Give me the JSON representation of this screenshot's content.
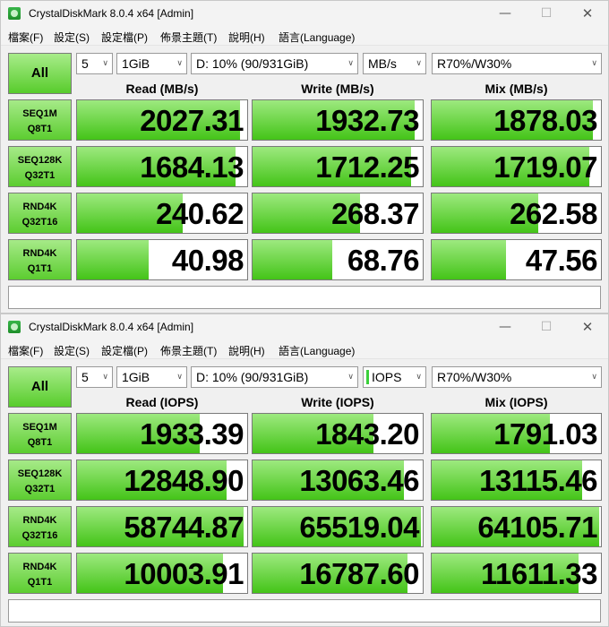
{
  "windows": [
    {
      "title": "CrystalDiskMark 8.0.4 x64 [Admin]",
      "controls": {
        "minimize": "—",
        "maximize": "☐",
        "close": "✕"
      },
      "menu": [
        "檔案(F)",
        "設定(S)",
        "設定檔(P)",
        "佈景主題(T)",
        "說明(H)",
        "語言(Language)"
      ],
      "toolbar": {
        "all_label": "All",
        "count": "5",
        "size": "1GiB",
        "drive": "D: 10% (90/931GiB)",
        "unit": "MB/s",
        "unit_marker": false,
        "mix": "R70%/W30%"
      },
      "columns": [
        "Read (MB/s)",
        "Write (MB/s)",
        "Mix (MB/s)"
      ],
      "rows": [
        {
          "label1": "SEQ1M",
          "label2": "Q8T1",
          "read": "2027.31",
          "write": "1932.73",
          "mix": "1878.03"
        },
        {
          "label1": "SEQ128K",
          "label2": "Q32T1",
          "read": "1684.13",
          "write": "1712.25",
          "mix": "1719.07"
        },
        {
          "label1": "RND4K",
          "label2": "Q32T16",
          "read": "240.62",
          "write": "268.37",
          "mix": "262.58"
        },
        {
          "label1": "RND4K",
          "label2": "Q1T1",
          "read": "40.98",
          "write": "68.76",
          "mix": "47.56"
        }
      ],
      "bar_fractions": [
        [
          0.96,
          0.95,
          0.95
        ],
        [
          0.93,
          0.93,
          0.93
        ],
        [
          0.62,
          0.63,
          0.63
        ],
        [
          0.42,
          0.47,
          0.44
        ]
      ],
      "comment": ""
    },
    {
      "title": "CrystalDiskMark 8.0.4 x64 [Admin]",
      "controls": {
        "minimize": "—",
        "maximize": "☐",
        "close": "✕"
      },
      "menu": [
        "檔案(F)",
        "設定(S)",
        "設定檔(P)",
        "佈景主題(T)",
        "說明(H)",
        "語言(Language)"
      ],
      "toolbar": {
        "all_label": "All",
        "count": "5",
        "size": "1GiB",
        "drive": "D: 10% (90/931GiB)",
        "unit": "IOPS",
        "unit_marker": true,
        "mix": "R70%/W30%"
      },
      "columns": [
        "Read (IOPS)",
        "Write (IOPS)",
        "Mix (IOPS)"
      ],
      "rows": [
        {
          "label1": "SEQ1M",
          "label2": "Q8T1",
          "read": "1933.39",
          "write": "1843.20",
          "mix": "1791.03"
        },
        {
          "label1": "SEQ128K",
          "label2": "Q32T1",
          "read": "12848.90",
          "write": "13063.46",
          "mix": "13115.46"
        },
        {
          "label1": "RND4K",
          "label2": "Q32T16",
          "read": "58744.87",
          "write": "65519.04",
          "mix": "64105.71"
        },
        {
          "label1": "RND4K",
          "label2": "Q1T1",
          "read": "10003.91",
          "write": "16787.60",
          "mix": "11611.33"
        }
      ],
      "bar_fractions": [
        [
          0.72,
          0.71,
          0.7
        ],
        [
          0.88,
          0.89,
          0.89
        ],
        [
          0.98,
          0.99,
          0.99
        ],
        [
          0.86,
          0.91,
          0.87
        ]
      ],
      "comment": ""
    }
  ],
  "colors": {
    "bar_green_top": "#9de97f",
    "bar_green_bottom": "#44c418",
    "label_green": "#5ccd30"
  }
}
